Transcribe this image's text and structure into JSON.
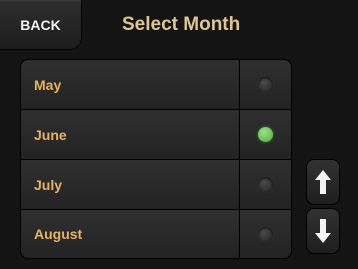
{
  "header": {
    "back_label": "BACK",
    "title": "Select Month"
  },
  "months": [
    {
      "label": "May",
      "selected": false
    },
    {
      "label": "June",
      "selected": true
    },
    {
      "label": "July",
      "selected": false
    },
    {
      "label": "August",
      "selected": false
    }
  ],
  "scroll": {
    "up_icon": "arrow-up-icon",
    "down_icon": "arrow-down-icon"
  },
  "colors": {
    "title": "#ddc690",
    "month_label": "#e9b35d",
    "selected_indicator": "#46b12e"
  }
}
